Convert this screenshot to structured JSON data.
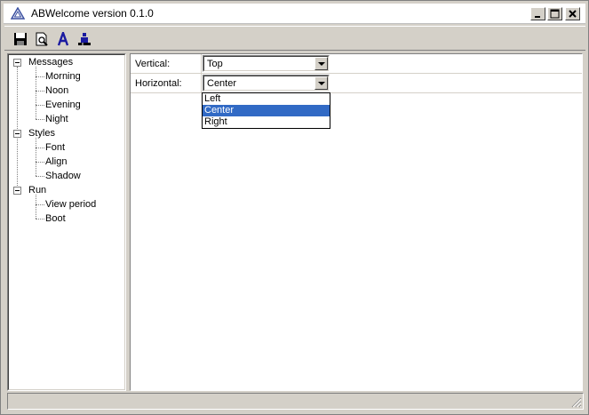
{
  "window": {
    "title": "ABWelcome version 0.1.0",
    "buttons": [
      "minimize",
      "maximize",
      "close"
    ]
  },
  "toolbar": {
    "tools": [
      {
        "name": "save",
        "icon": "floppy-disk-icon"
      },
      {
        "name": "preview",
        "icon": "print-preview-icon"
      },
      {
        "name": "font",
        "icon": "letter-a-icon"
      },
      {
        "name": "run",
        "icon": "person-icon"
      }
    ]
  },
  "tree": {
    "groups": [
      {
        "label": "Messages",
        "children": [
          "Morning",
          "Noon",
          "Evening",
          "Night"
        ]
      },
      {
        "label": "Styles",
        "children": [
          "Font",
          "Align",
          "Shadow"
        ]
      },
      {
        "label": "Run",
        "children": [
          "View period",
          "Boot"
        ]
      }
    ]
  },
  "properties": {
    "vertical": {
      "label": "Vertical:",
      "value": "Top"
    },
    "horizontal": {
      "label": "Horizontal:",
      "value": "Center"
    }
  },
  "dropdown": {
    "options": [
      "Left",
      "Center",
      "Right"
    ],
    "selected": "Center"
  },
  "colors": {
    "selection": "#316ac5",
    "chrome": "#d4d0c8"
  }
}
